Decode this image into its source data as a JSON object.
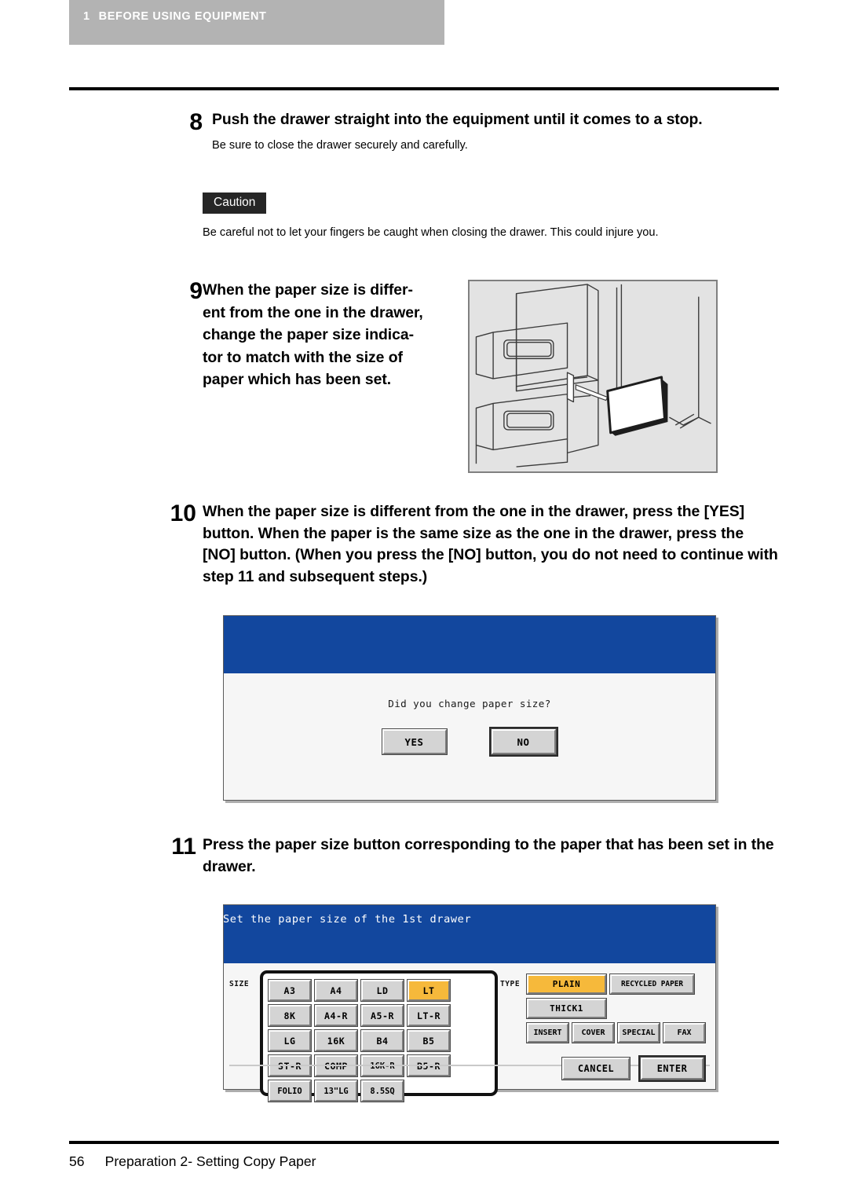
{
  "running_head": {
    "chapter_number": "1",
    "chapter_title": "BEFORE USING EQUIPMENT",
    "band_color": "#b3b3b3"
  },
  "steps": [
    {
      "number": "8",
      "heading": "Push the drawer straight into the equipment until it comes to a stop.",
      "subtext": "Be sure to close the drawer securely and carefully."
    },
    {
      "number": "9",
      "heading": "When the paper size is differ-\nent from the one in the drawer,\nchange the paper size indica-\ntor to match with the size of\npaper which has been set."
    },
    {
      "number": "10",
      "heading": "When the paper size is different from the one in the drawer, press the [YES] button. When the paper is the same size as the one in the drawer, press the [NO] button. (When you press the [NO] button, you do not need to continue with step 11 and subsequent steps.)"
    },
    {
      "number": "11",
      "heading": "Press the paper size button corresponding to the paper that has been set in the drawer."
    }
  ],
  "caution": {
    "label": "Caution",
    "text": "Be careful not to let your fingers be caught when closing the drawer. This could injure you.",
    "bg_color": "#262626"
  },
  "illustration": {
    "name": "drawer-paper-size-indicator-illustration",
    "caption": ""
  },
  "confirm_screen": {
    "title_bar_text": "",
    "title_bar_color": "#12479e",
    "message": "Did you change paper size?",
    "buttons": [
      {
        "label": "YES",
        "emphasized": false
      },
      {
        "label": "NO",
        "emphasized": true
      }
    ]
  },
  "paper_size_screen": {
    "title": "Set the paper size of the 1st drawer",
    "title_bar_color": "#12479e",
    "size_label": "SIZE",
    "type_label": "TYPE",
    "selected_size": "LT",
    "selected_type": "PLAIN",
    "highlight_color": "#f6b93b",
    "size_buttons": [
      "A3",
      "A4",
      "LD",
      "LT",
      "8K",
      "A4-R",
      "A5-R",
      "LT-R",
      "LG",
      "16K",
      "B4",
      "B5",
      "ST-R",
      "COMP",
      "16K-R",
      "B5-R",
      "FOLIO",
      "13\"LG",
      "8.5SQ"
    ],
    "type_buttons_row1": [
      "PLAIN",
      "RECYCLED PAPER"
    ],
    "type_buttons_row2": [
      "THICK1"
    ],
    "type_buttons_row3": [
      "INSERT",
      "COVER",
      "SPECIAL",
      "FAX"
    ],
    "footer_buttons": [
      {
        "label": "CANCEL",
        "emphasized": false
      },
      {
        "label": "ENTER",
        "emphasized": true
      }
    ]
  },
  "footer": {
    "page_number": "56",
    "section_title": "Preparation 2- Setting Copy Paper"
  }
}
